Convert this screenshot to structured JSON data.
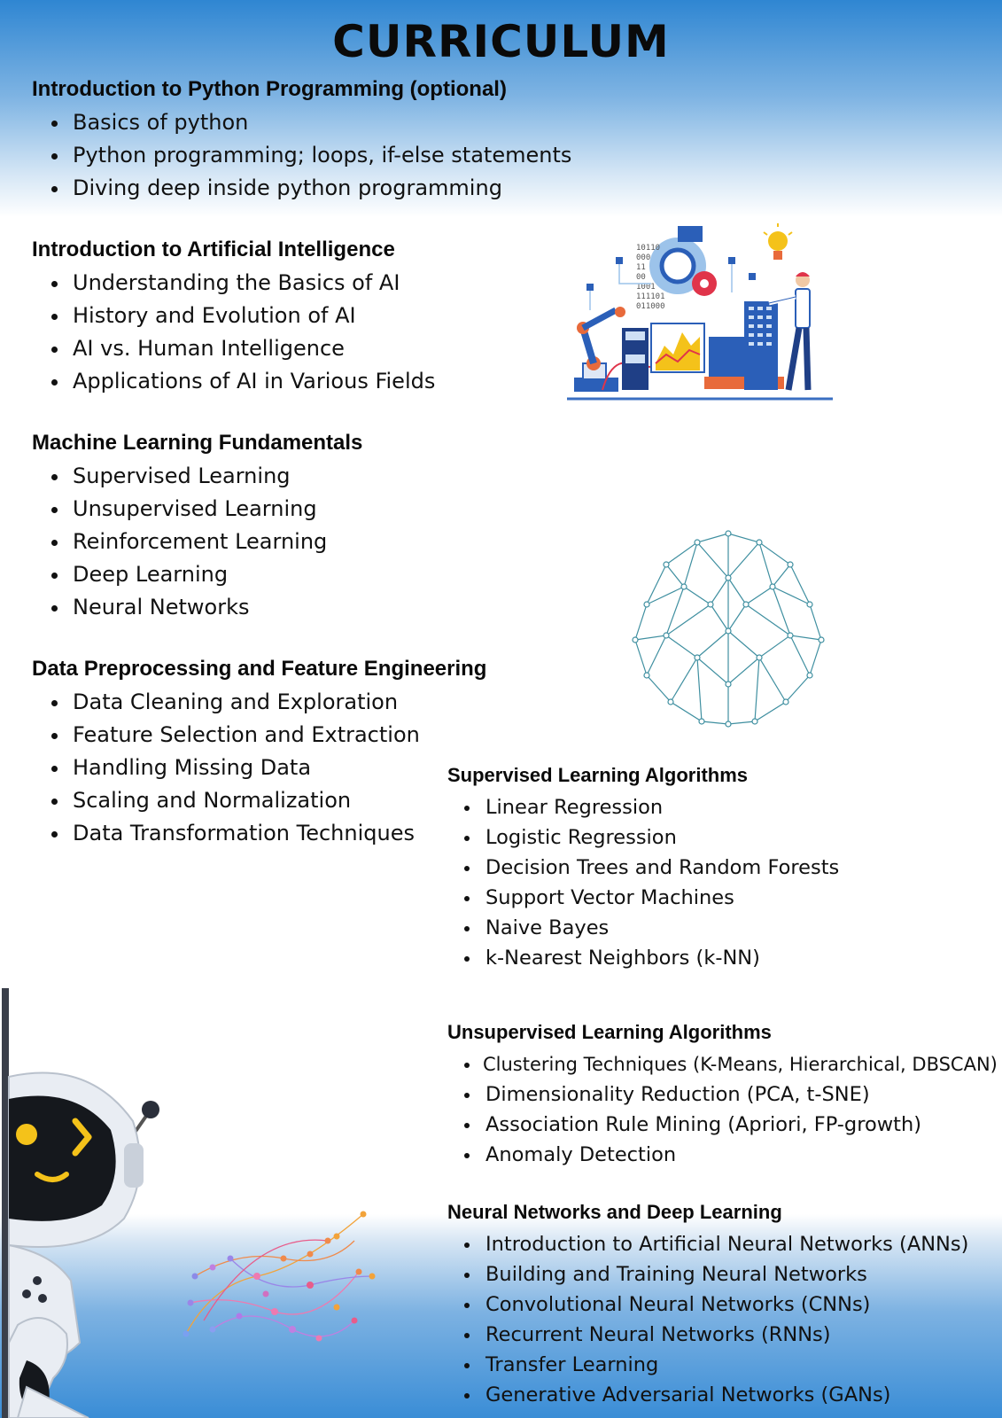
{
  "title": "CURRICULUM",
  "sections": [
    {
      "heading": "Introduction to Python Programming (optional)",
      "items": [
        "Basics of python",
        "Python programming; loops, if-else statements",
        "Diving deep inside python programming"
      ]
    },
    {
      "heading": "Introduction to Artificial Intelligence",
      "items": [
        "Understanding the Basics of AI",
        "History and Evolution of AI",
        "AI vs. Human Intelligence",
        "Applications of AI in Various Fields"
      ]
    },
    {
      "heading": "Machine Learning Fundamentals",
      "items": [
        "Supervised Learning",
        "Unsupervised Learning",
        "Reinforcement Learning",
        "Deep Learning",
        "Neural Networks"
      ]
    },
    {
      "heading": "Data Preprocessing and Feature Engineering",
      "items": [
        "Data Cleaning and Exploration",
        "Feature Selection and Extraction",
        "Handling Missing Data",
        "Scaling and Normalization",
        "Data Transformation Techniques"
      ]
    },
    {
      "heading": "Supervised Learning Algorithms",
      "items": [
        "Linear Regression",
        "Logistic Regression",
        "Decision Trees and Random Forests",
        "Support Vector Machines",
        "Naive Bayes",
        "k-Nearest Neighbors (k-NN)"
      ]
    },
    {
      "heading": "Unsupervised Learning Algorithms",
      "items": [
        "Clustering Techniques (K-Means, Hierarchical, DBSCAN)",
        "Dimensionality Reduction (PCA, t-SNE)",
        "Association Rule Mining (Apriori, FP-growth)",
        "Anomaly Detection"
      ]
    },
    {
      "heading": "Neural Networks and Deep Learning",
      "items": [
        "Introduction to Artificial Neural Networks (ANNs)",
        "Building and Training Neural Networks",
        "Convolutional Neural Networks (CNNs)",
        "Recurrent Neural Networks (RNNs)",
        "Transfer Learning",
        "Generative Adversarial Networks (GANs)"
      ]
    }
  ],
  "illustration": {
    "binary_lines": [
      "10110",
      "000",
      "11",
      "00",
      "1001",
      "111101",
      "011000"
    ]
  },
  "colors": {
    "header_blue": "#2f86d2",
    "brain_teal": "#3f8fa0"
  }
}
